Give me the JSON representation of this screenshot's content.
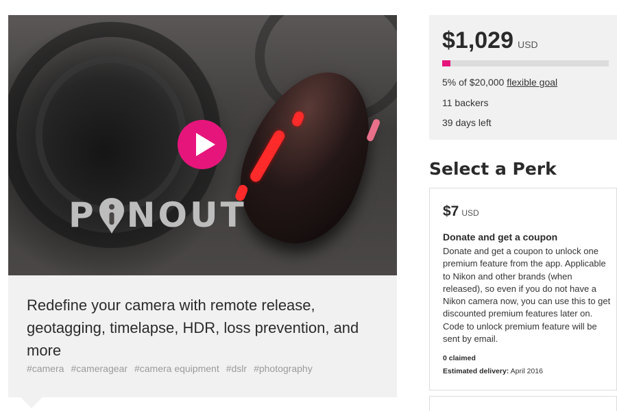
{
  "video": {
    "logo_text_left": "P",
    "logo_text_right": "NOUT",
    "accent_color": "#e6157c"
  },
  "campaign": {
    "tagline": "Redefine your camera with remote release, geotagging, timelapse, HDR, loss prevention, and more",
    "tags": [
      "#camera",
      "#cameragear",
      "#camera equipment",
      "#dslr",
      "#photography"
    ]
  },
  "funding": {
    "amount": "$1,029",
    "currency": "USD",
    "percent_funded": 5,
    "goal_prefix": "5% of $20,000",
    "goal_link": "flexible goal",
    "backers": "11 backers",
    "days_left": "39 days left"
  },
  "perks": {
    "heading": "Select a Perk",
    "items": [
      {
        "price": "$7",
        "currency": "USD",
        "title": "Donate and get a coupon",
        "description": "Donate and get a coupon to unlock one premium feature from the app. Applicable to Nikon and other brands (when released), so even if you do not have a Nikon camera now, you can use this to get discounted premium features later on. Code to unlock premium feature will be sent by email.",
        "claimed": "0 claimed",
        "delivery_label": "Estimated delivery:",
        "delivery_value": "April 2016"
      }
    ]
  }
}
